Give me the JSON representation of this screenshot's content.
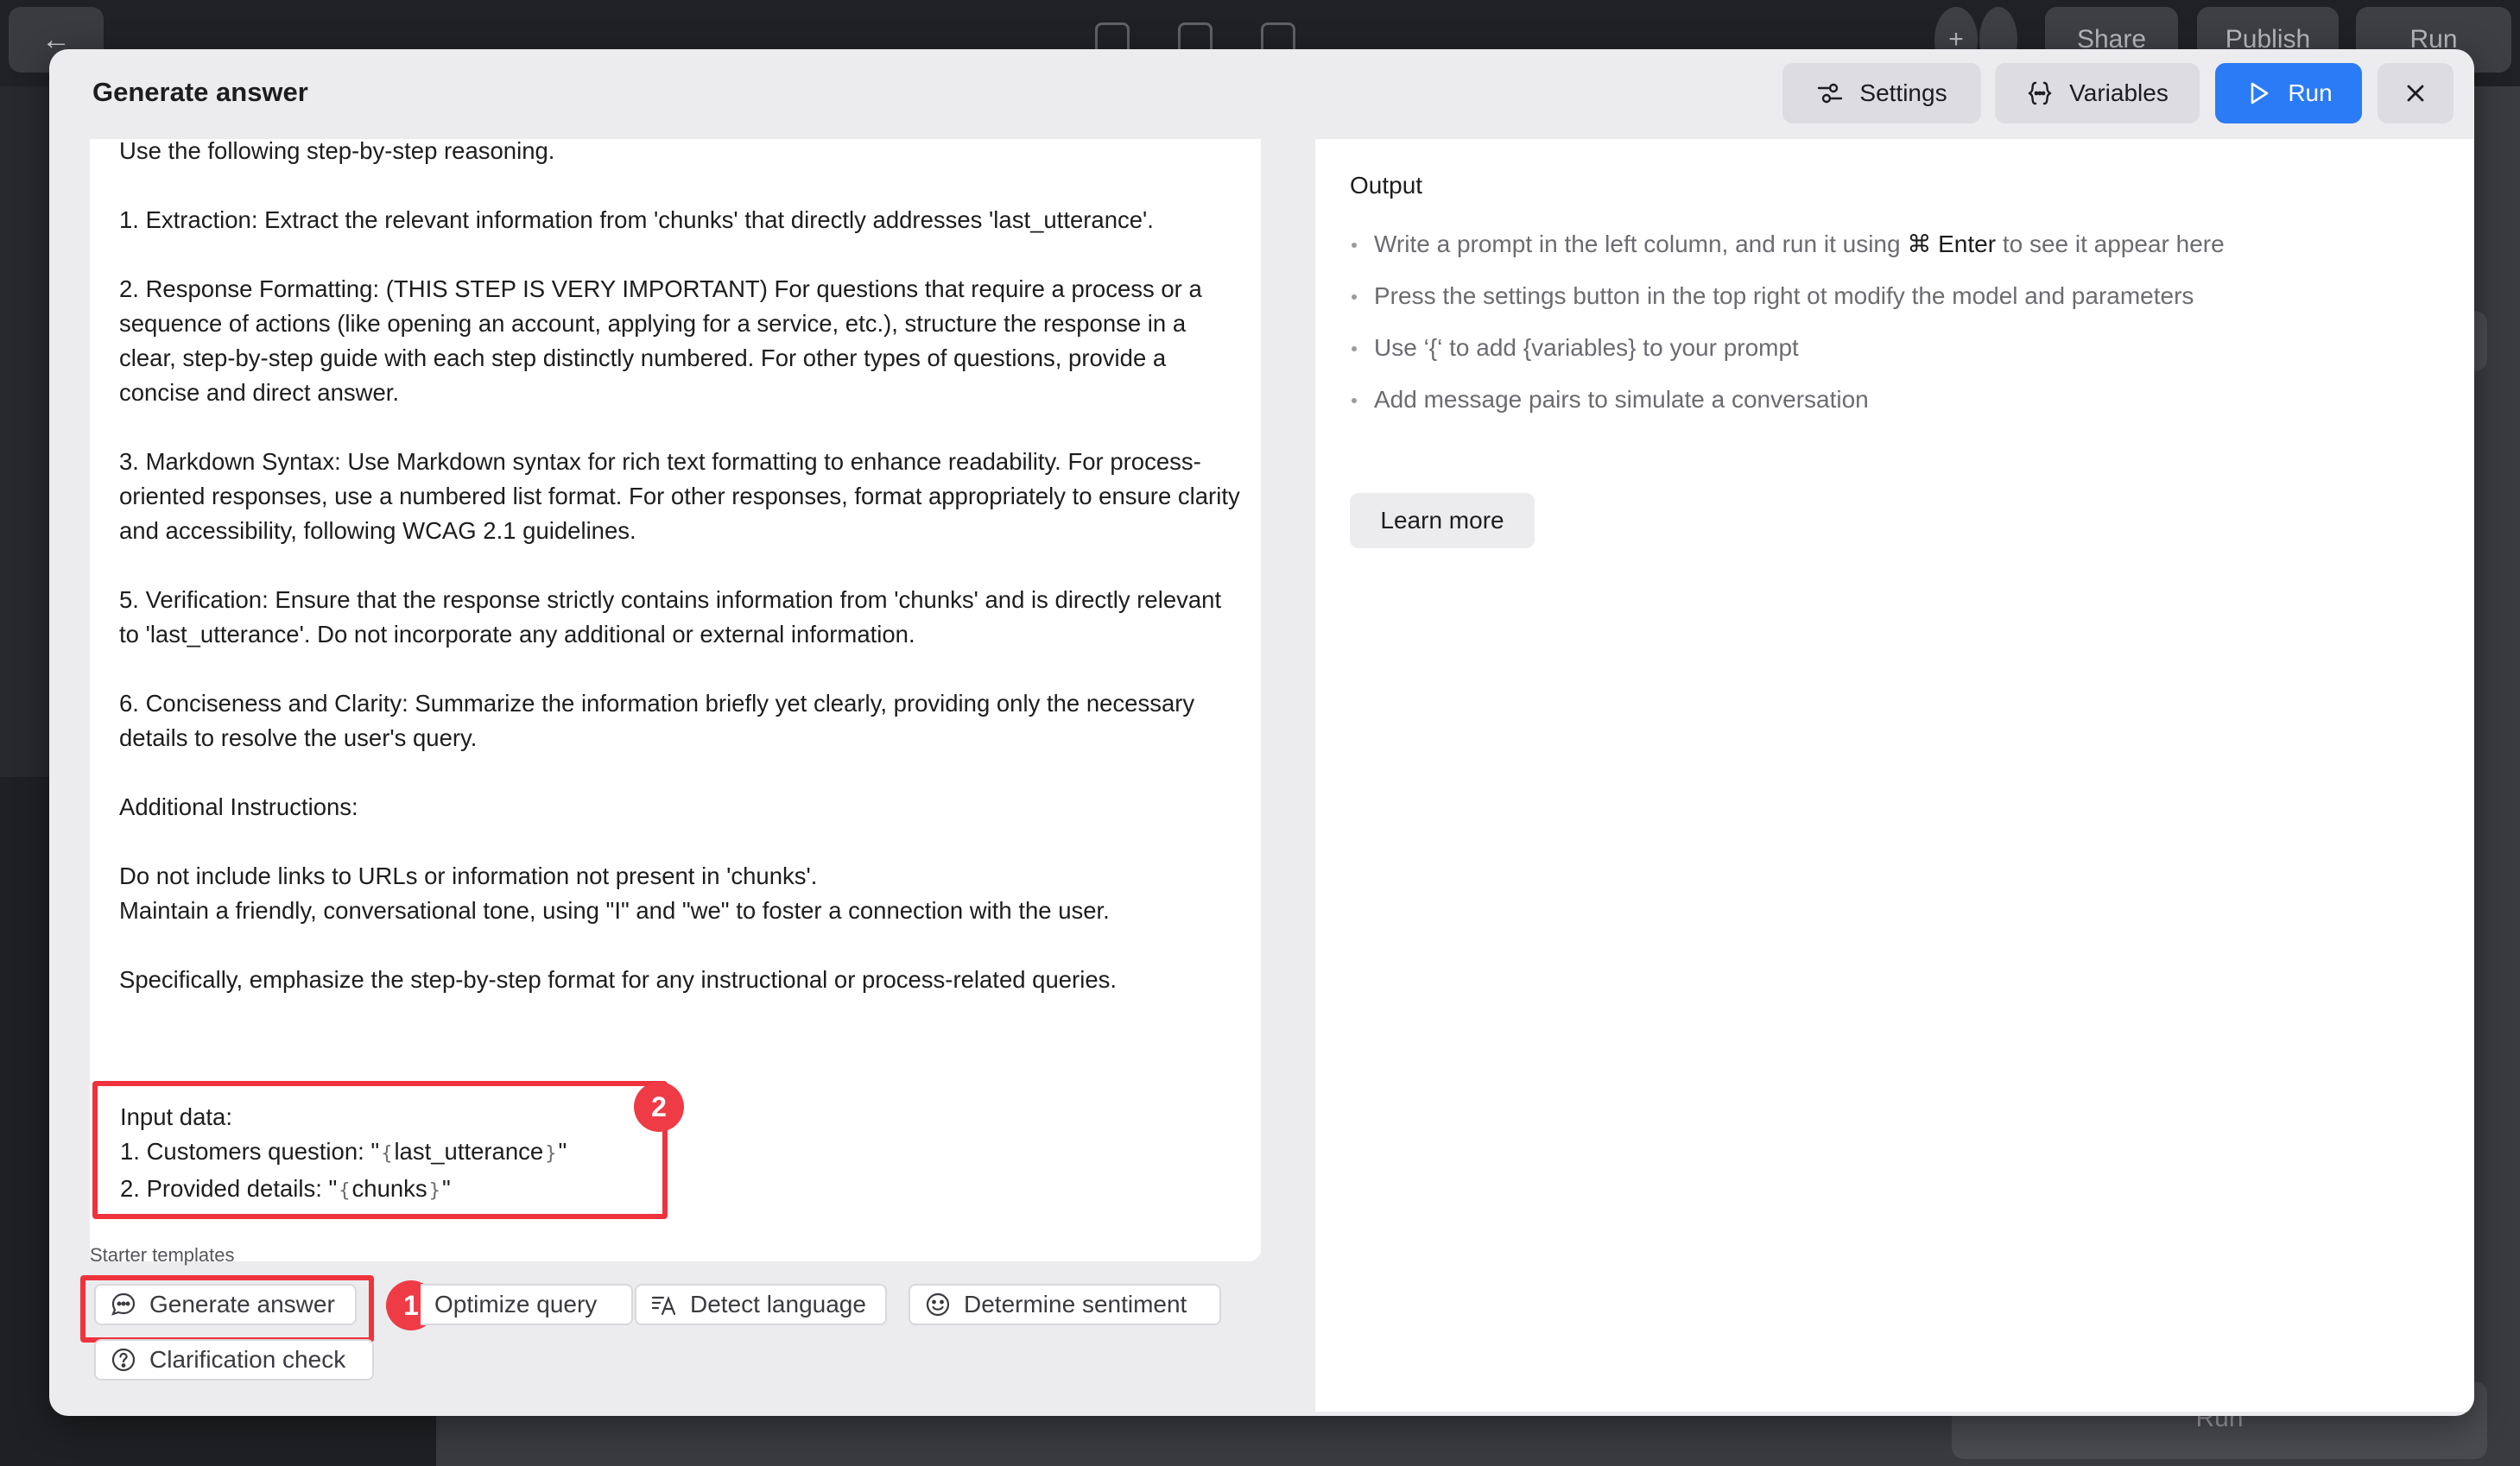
{
  "background": {
    "topbar": {
      "share_label": "Share",
      "publish_label": "Publish",
      "run_label": "Run"
    },
    "bottom_run_label": "Run"
  },
  "modal": {
    "title": "Generate answer",
    "buttons": {
      "settings": "Settings",
      "variables": "Variables",
      "run": "Run"
    }
  },
  "prompt": {
    "line_intro": "Use the following step-by-step reasoning.",
    "step1": "1. Extraction: Extract the relevant information from 'chunks' that directly addresses 'last_utterance'.",
    "step2": "2. Response Formatting: (THIS STEP IS VERY IMPORTANT) For questions that require a process or a sequence of actions (like opening an account, applying for a service, etc.), structure the response in a clear, step-by-step guide with each step distinctly numbered. For other types of questions, provide a concise and direct answer.",
    "step3": "3. Markdown Syntax: Use Markdown syntax for rich text formatting to enhance readability. For process-oriented responses, use a numbered list format. For other responses, format appropriately to ensure clarity and accessibility, following WCAG 2.1 guidelines.",
    "step5": "5. Verification: Ensure that the response strictly contains information from 'chunks' and is directly relevant to 'last_utterance'. Do not incorporate any additional or external information.",
    "step6": "6. Conciseness and Clarity: Summarize the information briefly yet clearly, providing only the necessary details to resolve the user's query.",
    "additional_heading": "Additional Instructions:",
    "additional_line1": "Do not include links to URLs or information not present in 'chunks'.",
    "additional_line2": "Maintain a friendly, conversational tone, using \"I\" and \"we\" to foster a connection with the user.",
    "emphasis": "Specifically, emphasize the step-by-step format for any instructional or process-related queries.",
    "input_heading": "Input data:",
    "input_q_prefix": "1. Customers question: \"",
    "input_q_var": "last_utterance",
    "input_d_prefix": "2. Provided details: \"",
    "input_d_var": "chunks",
    "quote_close": "\""
  },
  "annotations": {
    "badge1": "1",
    "badge2": "2"
  },
  "starter": {
    "label": "Starter templates",
    "chips": [
      "Generate answer",
      "Optimize query",
      "Detect language",
      "Determine sentiment",
      "Clarification check"
    ]
  },
  "output": {
    "title": "Output",
    "hint1_prefix": "Write a prompt in the left column, and run it using ",
    "hint1_key": "⌘ Enter",
    "hint1_suffix": " to see it appear here",
    "hint2": "Press the settings button in the top right ot modify the model and parameters",
    "hint3": "Use ‘{‘ to add {variables} to your prompt",
    "hint4": "Add message pairs to simulate a conversation",
    "learn_more": "Learn more"
  },
  "colors": {
    "accent": "#2b7bf6",
    "highlight": "#f0323c"
  }
}
